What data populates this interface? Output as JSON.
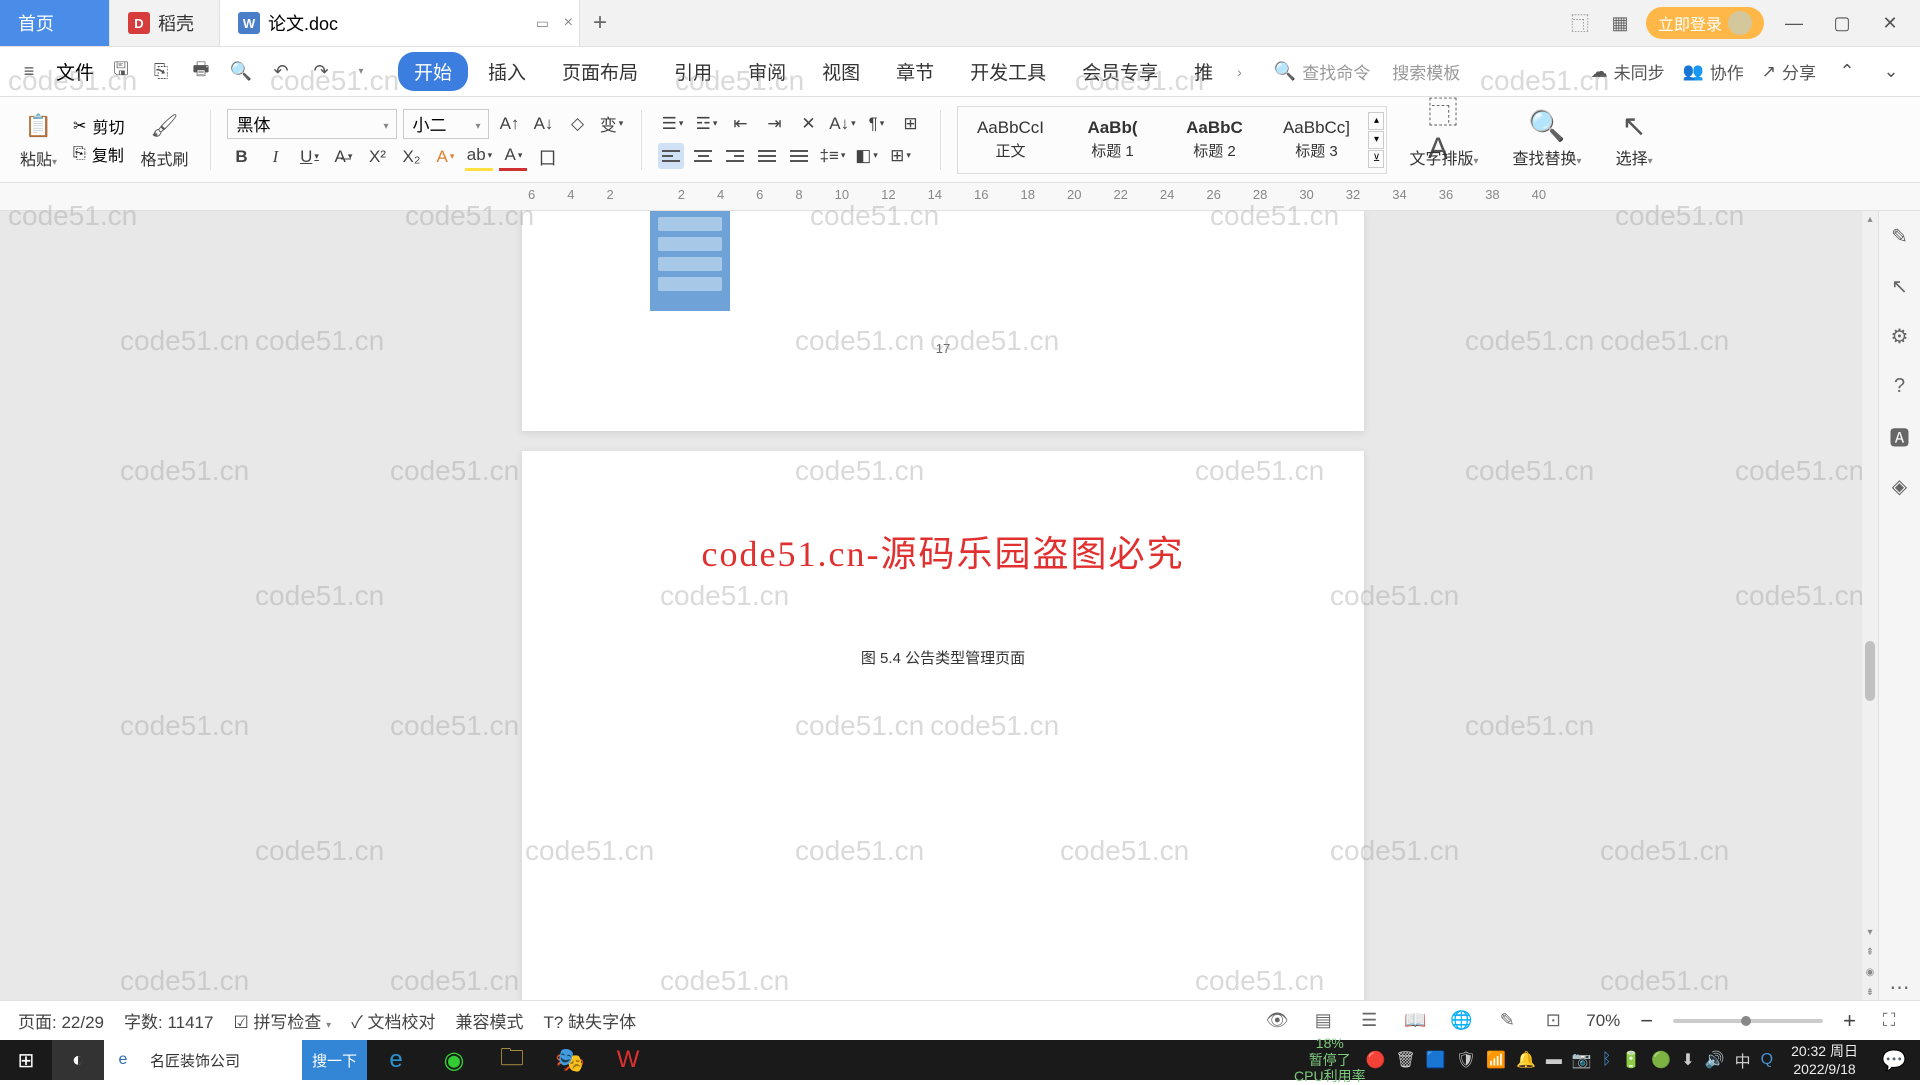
{
  "tabs": {
    "home": "首页",
    "docer": "稻壳",
    "doc": "论文.doc"
  },
  "titlebar": {
    "login": "立即登录"
  },
  "qat": {
    "file": "文件"
  },
  "menu": {
    "items": [
      "开始",
      "插入",
      "页面布局",
      "引用",
      "审阅",
      "视图",
      "章节",
      "开发工具",
      "会员专享",
      "推"
    ],
    "search_cmd": "查找命令",
    "search_tpl": "搜索模板",
    "unsync": "未同步",
    "collab": "协作",
    "share": "分享"
  },
  "ribbon": {
    "paste": "粘贴",
    "cut": "剪切",
    "copy": "复制",
    "format_painter": "格式刷",
    "font": "黑体",
    "size": "小二",
    "styles": [
      {
        "preview": "AaBbCcI",
        "name": "正文"
      },
      {
        "preview": "AaBb(",
        "name": "标题 1"
      },
      {
        "preview": "AaBbC",
        "name": "标题 2"
      },
      {
        "preview": "AaBbCc]",
        "name": "标题 3"
      }
    ],
    "text_layout": "文字排版",
    "find_replace": "查找替换",
    "select": "选择"
  },
  "ruler": [
    "6",
    "4",
    "2",
    "",
    "2",
    "4",
    "6",
    "8",
    "10",
    "12",
    "14",
    "16",
    "18",
    "20",
    "22",
    "24",
    "26",
    "28",
    "30",
    "32",
    "34",
    "36",
    "38",
    "40"
  ],
  "doc": {
    "pagenum": "17",
    "banner": "code51.cn-源码乐园盗图必究",
    "caption": "图 5.4 公告类型管理页面",
    "watermark": "code51.cn"
  },
  "status": {
    "page": "页面: 22/29",
    "words": "字数: 11417",
    "spell": "拼写检查",
    "proof": "文档校对",
    "compat": "兼容模式",
    "missing_font": "缺失字体",
    "zoom": "70%",
    "cpu_pct": "18%",
    "cpu_label": "CPU利用率",
    "paused": "暂停了"
  },
  "taskbar": {
    "search_text": "名匠装饰公司",
    "search_btn": "搜一下",
    "time": "20:32",
    "day": "周日",
    "date": "2022/9/18",
    "ime": "中"
  }
}
